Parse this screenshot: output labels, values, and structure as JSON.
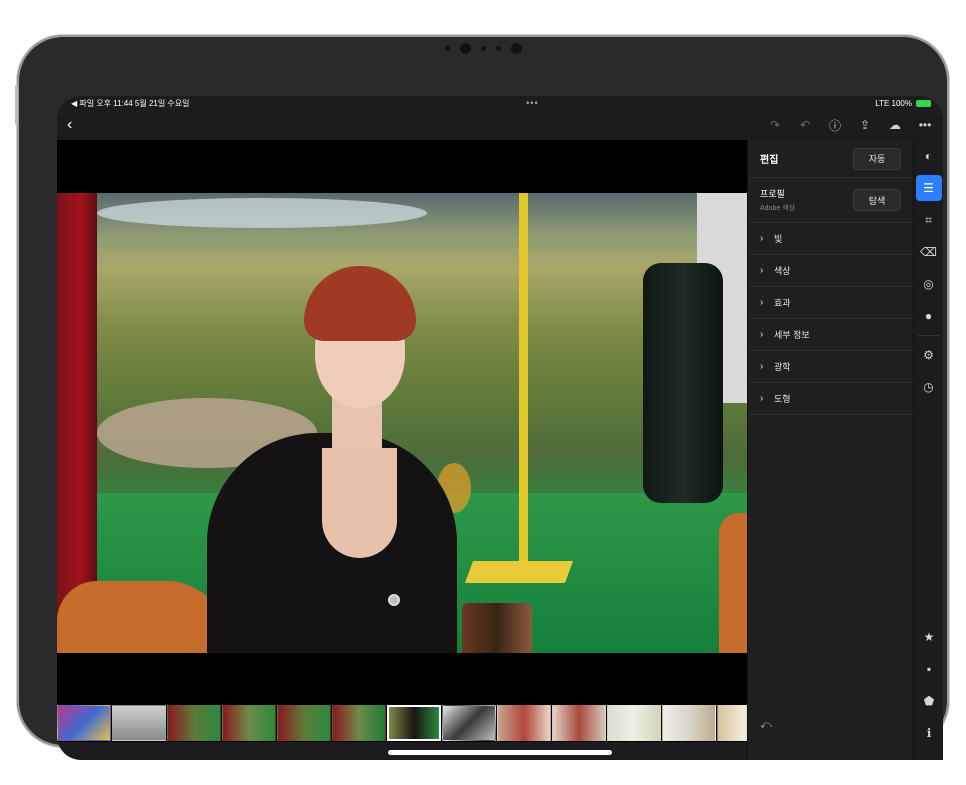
{
  "status_bar": {
    "left": "◀ 파일  오후 11:44  5월 21일 수요일",
    "center": "•••",
    "right": "LTE  100%"
  },
  "toolbar": {
    "back_icon": "chevron-left-icon",
    "redo_icon": "redo-icon",
    "undo_icon": "undo-icon",
    "help_icon": "help-icon",
    "share_icon": "share-icon",
    "cloud_icon": "cloud-sync-icon",
    "more_icon": "more-icon"
  },
  "edit_panel": {
    "title": "편집",
    "auto_button": "자동",
    "profile_label": "프로필",
    "profile_value": "Adobe 색상",
    "browse_button": "탐색",
    "sections": [
      {
        "label": "빛"
      },
      {
        "label": "색상"
      },
      {
        "label": "효과"
      },
      {
        "label": "세부 정보"
      },
      {
        "label": "광학"
      },
      {
        "label": "도형"
      }
    ]
  },
  "tool_rail": {
    "items": [
      "presets-icon",
      "edit-sliders-icon",
      "crop-icon",
      "heal-eraser-icon",
      "masking-icon",
      "blur-drop-icon",
      "versions-icon",
      "history-icon"
    ],
    "bottom": [
      "rating-star-icon",
      "comment-icon",
      "tag-icon",
      "info-icon"
    ]
  },
  "filmstrip": {
    "count": 13,
    "selected_index": 6
  }
}
